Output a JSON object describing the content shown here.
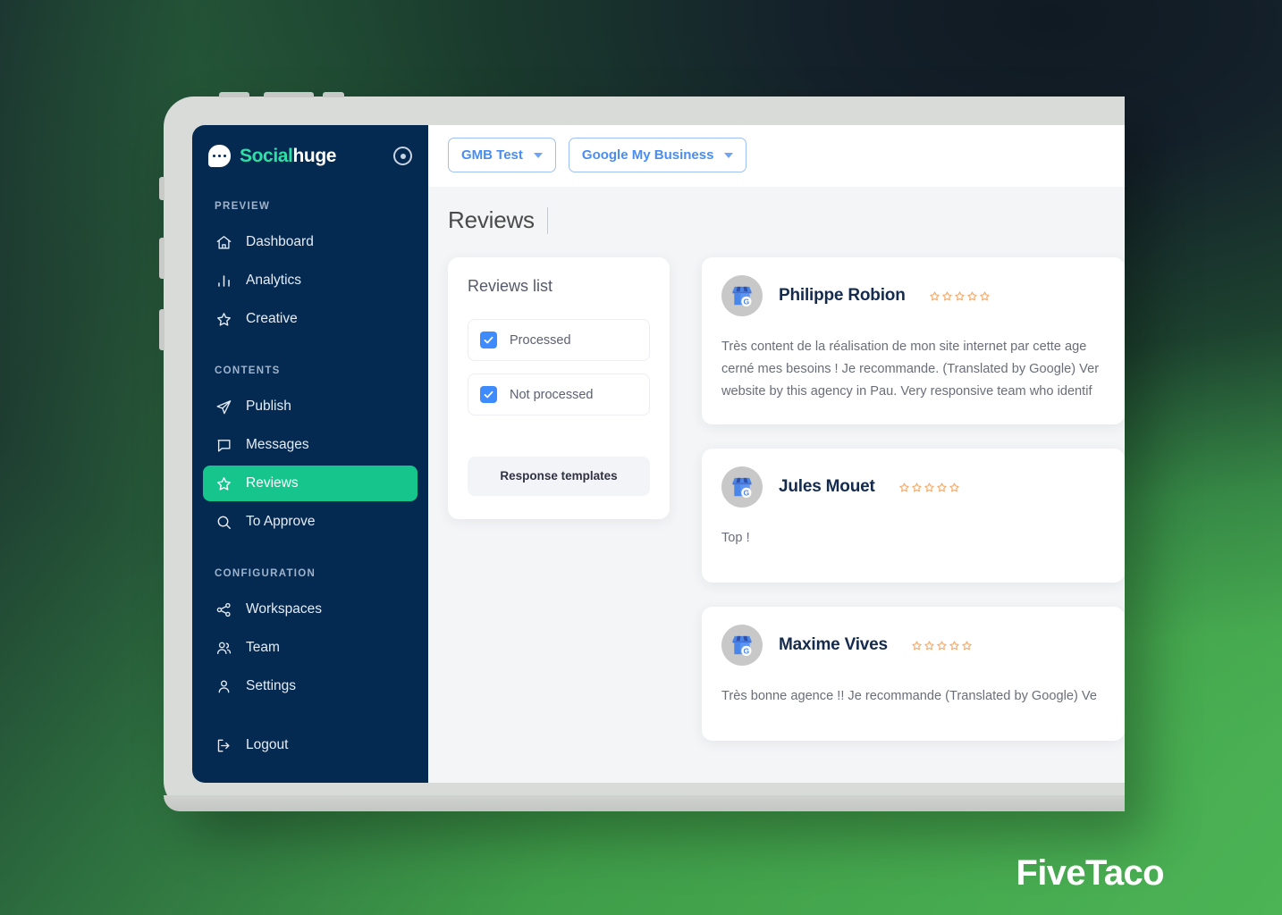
{
  "brand": {
    "name_part1": "Social",
    "name_part2": "huge",
    "mark_icon": "chat-bubble-icon",
    "action_icon": "target-circle-icon"
  },
  "sidebar": {
    "groups": [
      {
        "title": "PREVIEW",
        "items": [
          {
            "label": "Dashboard",
            "icon": "home-icon",
            "active": false
          },
          {
            "label": "Analytics",
            "icon": "bar-chart-icon",
            "active": false
          },
          {
            "label": "Creative",
            "icon": "star-icon",
            "active": false
          }
        ]
      },
      {
        "title": "CONTENTS",
        "items": [
          {
            "label": "Publish",
            "icon": "send-icon",
            "active": false
          },
          {
            "label": "Messages",
            "icon": "chat-icon",
            "active": false
          },
          {
            "label": "Reviews",
            "icon": "star-icon",
            "active": true
          },
          {
            "label": "To Approve",
            "icon": "search-icon",
            "active": false
          }
        ]
      },
      {
        "title": "CONFIGURATION",
        "items": [
          {
            "label": "Workspaces",
            "icon": "share-nodes-icon",
            "active": false
          },
          {
            "label": "Team",
            "icon": "users-icon",
            "active": false
          },
          {
            "label": "Settings",
            "icon": "user-icon",
            "active": false
          }
        ]
      }
    ],
    "logout": {
      "label": "Logout",
      "icon": "logout-icon"
    }
  },
  "topbar": {
    "workspace_selector": {
      "label": "GMB Test",
      "icon": "chevron-down-icon"
    },
    "channel_selector": {
      "label": "Google My Business",
      "icon": "chevron-down-icon"
    }
  },
  "page": {
    "title": "Reviews"
  },
  "reviews_list_panel": {
    "title": "Reviews list",
    "filters": [
      {
        "label": "Processed",
        "checked": true
      },
      {
        "label": "Not processed",
        "checked": true
      }
    ],
    "templates_button": "Response\ntemplates"
  },
  "reviews": [
    {
      "author": "Philippe Robion",
      "avatar_icon": "google-my-business-icon",
      "rating": 5,
      "rating_filled": 0,
      "text": "Très content de la réalisation de mon site internet par cette age\ncerné mes besoins ! Je recommande. (Translated by Google) Ver\nwebsite by this agency in Pau. Very responsive team who identif"
    },
    {
      "author": "Jules Mouet",
      "avatar_icon": "google-my-business-icon",
      "rating": 5,
      "rating_filled": 0,
      "text": "Top !"
    },
    {
      "author": "Maxime Vives",
      "avatar_icon": "google-my-business-icon",
      "rating": 5,
      "rating_filled": 0,
      "text": "Très bonne agence !! Je recommande (Translated by Google) Ve"
    }
  ],
  "watermark": {
    "text": "FiveTaco"
  },
  "colors": {
    "sidebar_bg": "#042a52",
    "accent_teal": "#15c58c",
    "brand_teal": "#2ee0a6",
    "link_blue": "#4a8df0",
    "checkbox_blue": "#3d8bfd",
    "star_orange": "#f5a662",
    "background_green": "#4cb455"
  }
}
